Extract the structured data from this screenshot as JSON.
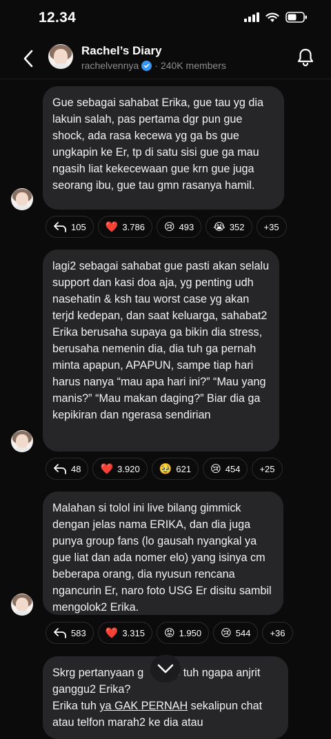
{
  "status": {
    "time": "12.34"
  },
  "header": {
    "title": "Rachel’s Diary",
    "handle": "rachelvennya",
    "separator": "·",
    "members": "240K members"
  },
  "messages": [
    {
      "text": "Gue sebagai sahabat Erika, gue tau yg dia lakuin salah, pas pertama dgr pun gue shock, ada rasa kecewa yg ga bs gue ungkapin ke Er, tp di satu sisi gue ga mau ngasih liat kekecewaan gue krn gue juga seorang ibu, gue tau gmn rasanya hamil.",
      "reply_count": "105",
      "reactions": [
        {
          "emoji": "❤️",
          "count": "3.786"
        },
        {
          "emoji": "😢",
          "count": "493"
        },
        {
          "emoji": "😭",
          "count": "352"
        }
      ],
      "more": "+35"
    },
    {
      "text": "lagi2 sebagai sahabat gue pasti akan selalu support dan kasi doa aja, yg penting udh nasehatin & ksh tau worst case yg akan terjd kedepan, dan saat keluarga, sahabat2 Erika berusaha supaya ga bikin dia stress, berusaha nemenin dia, dia tuh ga pernah minta apapun, APAPUN, sampe tiap hari harus nanya “mau apa hari ini?” “Mau yang manis?” “Mau makan daging?” Biar dia ga kepikiran dan ngerasa sendirian",
      "reply_count": "48",
      "reactions": [
        {
          "emoji": "❤️",
          "count": "3.920"
        },
        {
          "emoji": "🥹",
          "count": "621"
        },
        {
          "emoji": "😢",
          "count": "454"
        }
      ],
      "more": "+25"
    },
    {
      "text": "Malahan si tolol ini live bilang gimmick dengan jelas nama ERIKA, dan dia juga punya group fans (lo gausah nyangkal ya gue liat dan ada nomer elo) yang isinya cm beberapa orang, dia nyusun rencana ngancurin Er, naro foto USG Er disitu sambil mengolok2 Erika.",
      "reply_count": "583",
      "reactions": [
        {
          "emoji": "❤️",
          "count": "3.315"
        },
        {
          "emoji": "😡",
          "count": "1.950"
        },
        {
          "emoji": "😢",
          "count": "544"
        }
      ],
      "more": "+36"
    },
    {
      "text_a": "Skrg pertanyaan g",
      "text_b": "o tuh ngapa anjrit ganggu2 Erika?",
      "text_c": "Erika tuh ",
      "text_d": "ya GAK PERNAH",
      "text_e": " sekalipun chat atau telfon marah2 ke dia atau"
    }
  ]
}
